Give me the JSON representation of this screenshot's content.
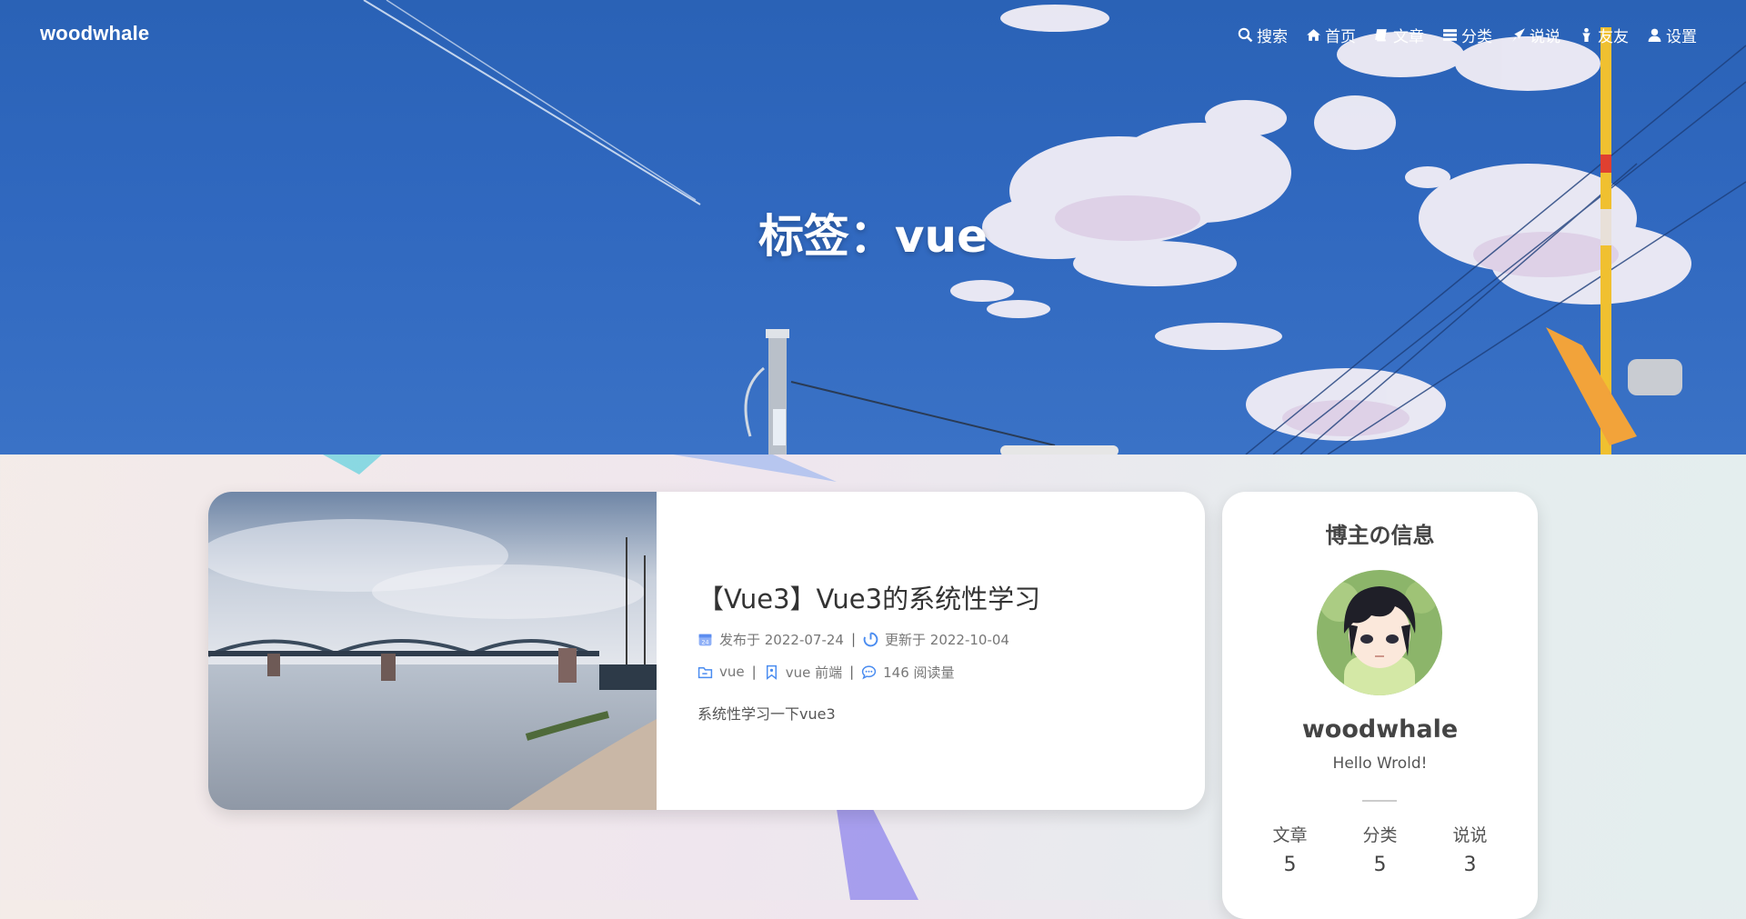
{
  "site": {
    "brand": "woodwhale"
  },
  "nav": {
    "items": [
      {
        "label": "搜索",
        "icon": "search-icon"
      },
      {
        "label": "首页",
        "icon": "home-icon"
      },
      {
        "label": "文章",
        "icon": "book-icon"
      },
      {
        "label": "分类",
        "icon": "list-icon"
      },
      {
        "label": "说说",
        "icon": "rocket-icon"
      },
      {
        "label": "友友",
        "icon": "person-icon"
      },
      {
        "label": "设置",
        "icon": "user-icon"
      }
    ]
  },
  "hero": {
    "title": "标签：vue"
  },
  "post": {
    "title": "【Vue3】Vue3的系统性学习",
    "published_label": "发布于 2022-07-24",
    "updated_label": "更新于 2022-10-04",
    "category": "vue",
    "tags": "vue 前端",
    "reads": "146 阅读量",
    "separator": "|",
    "excerpt": "系统性学习一下vue3"
  },
  "author": {
    "heading": "博主の信息",
    "name": "woodwhale",
    "bio": "Hello Wrold!",
    "stats": [
      {
        "label": "文章",
        "value": "5"
      },
      {
        "label": "分类",
        "value": "5"
      },
      {
        "label": "说说",
        "value": "3"
      }
    ]
  },
  "colors": {
    "accent": "#4a8cf0",
    "sky": "#2e66bb",
    "card": "#ffffff"
  }
}
